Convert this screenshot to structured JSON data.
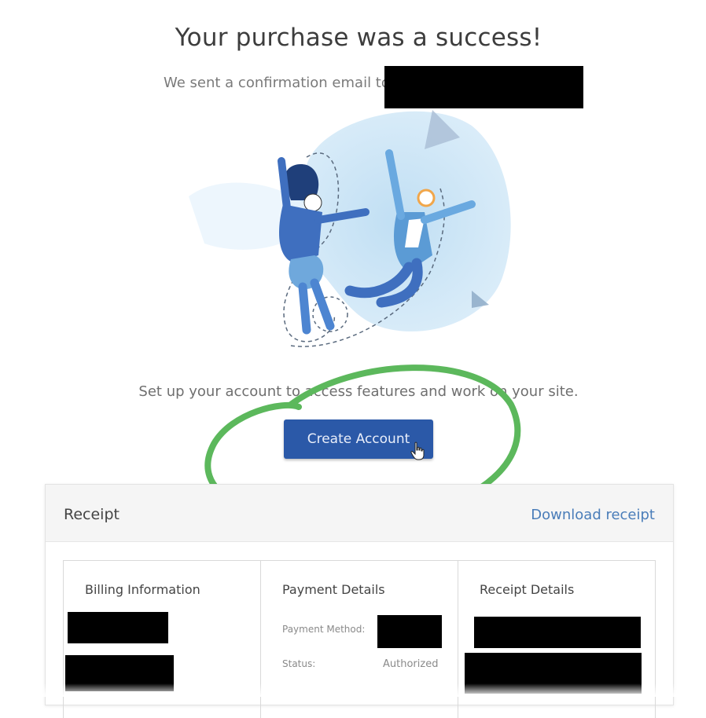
{
  "success": {
    "title": "Your purchase was a success!",
    "email_text": "We sent a confirmation email to"
  },
  "setup": {
    "text": "Set up your account to access features and work on your site.",
    "create_button": "Create Account"
  },
  "receipt": {
    "title": "Receipt",
    "download_link": "Download receipt",
    "billing": {
      "heading": "Billing Information"
    },
    "payment": {
      "heading": "Payment Details",
      "method_label": "Payment Method:",
      "status_label": "Status:",
      "status_value": "Authorized"
    },
    "details": {
      "heading": "Receipt Details"
    }
  },
  "colors": {
    "button": "#2b59a8",
    "link": "#4a7db9",
    "annotation": "#5cb85c",
    "illustration_primary": "#3f6fbf"
  },
  "icons": [
    "hand-pointer-cursor"
  ]
}
